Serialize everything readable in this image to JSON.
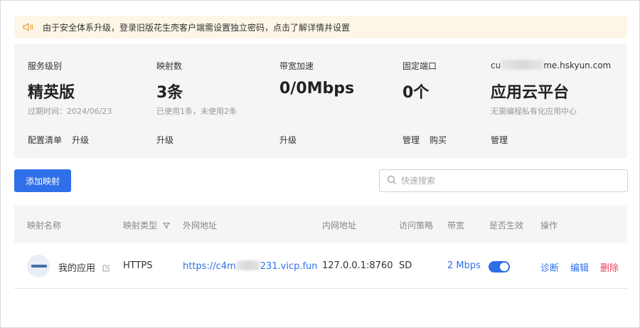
{
  "notice": {
    "text": "由于安全体系升级，登录旧版花生壳客户端需设置独立密码，点击了解详情并设置"
  },
  "stats": {
    "service": {
      "label": "服务级别",
      "value": "精英版",
      "sub": "过期时间：2024/06/23",
      "actions": [
        "配置清单",
        "升级"
      ]
    },
    "mappings": {
      "label": "映射数",
      "value": "3条",
      "sub": "已使用1条，未使用2条",
      "actions": [
        "升级"
      ]
    },
    "bandwidth": {
      "label": "带宽加速",
      "value": "0/0Mbps",
      "actions": [
        "升级"
      ]
    },
    "port": {
      "label": "固定端口",
      "value": "0个",
      "actions": [
        "管理",
        "购买"
      ]
    },
    "cloud": {
      "label_prefix": "cu",
      "label_suffix": "me.hskyun.com",
      "value": "应用云平台",
      "sub": "无需编程私有化应用中心",
      "actions": [
        "管理"
      ]
    }
  },
  "toolbar": {
    "add_label": "添加映射",
    "search_placeholder": "快速搜索"
  },
  "table": {
    "headers": [
      "映射名称",
      "映射类型",
      "外网地址",
      "内网地址",
      "访问策略",
      "带宽",
      "是否生效",
      "操作"
    ],
    "rows": [
      {
        "name": "我的应用",
        "type": "HTTPS",
        "external_prefix": "https://c4m",
        "external_suffix": "231.vicp.fun",
        "internal": "127.0.0.1:8760",
        "policy": "SD",
        "bandwidth": "2 Mbps",
        "enabled": true,
        "actions": {
          "diagnose": "诊断",
          "edit": "编辑",
          "delete": "删除"
        }
      }
    ]
  },
  "colors": {
    "accent": "#2f6fe8",
    "danger": "#e0405a",
    "notice_bg": "#fdf6e7",
    "panel_bg": "#f5f5f6"
  },
  "icons": {
    "notice": "speaker-icon",
    "search": "search-icon",
    "filter": "filter-icon",
    "edit_name": "edit-icon"
  }
}
